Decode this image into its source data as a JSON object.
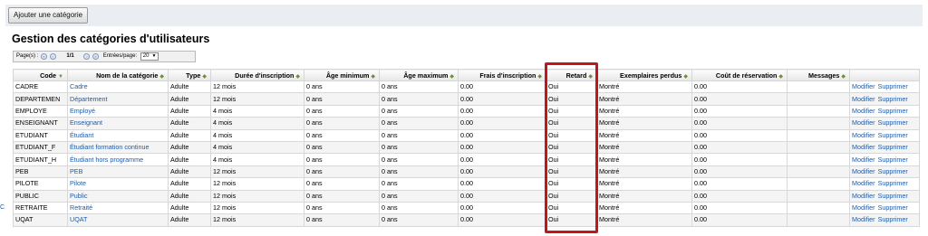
{
  "toolbar": {
    "add_category_label": "Ajouter une catégorie"
  },
  "page": {
    "title": "Gestion des catégories d'utilisateurs"
  },
  "pager": {
    "pages_label": "Page(s) :",
    "page_count": "1/1",
    "entries_label": "Entrées/page:",
    "entries_value": "20"
  },
  "columns": [
    "Code",
    "Nom de la catégorie",
    "Type",
    "Durée d'inscription",
    "Âge minimum",
    "Âge maximum",
    "Frais d'inscription",
    "Retard",
    "Exemplaires perdus",
    "Coût de réservation",
    "Messages",
    ""
  ],
  "rows": [
    {
      "code": "CADRE",
      "name": "Cadre",
      "type": "Adulte",
      "duration": "12 mois",
      "age_min": "0 ans",
      "age_max": "0 ans",
      "fee": "0.00",
      "overdue": "Oui",
      "lost": "Montré",
      "reserve_fee": "0.00",
      "messages": "",
      "edit": "Modifier",
      "delete": "Supprimer"
    },
    {
      "code": "DEPARTEMEN",
      "name": "Département",
      "type": "Adulte",
      "duration": "12 mois",
      "age_min": "0 ans",
      "age_max": "0 ans",
      "fee": "0.00",
      "overdue": "Oui",
      "lost": "Montré",
      "reserve_fee": "0.00",
      "messages": "",
      "edit": "Modifier",
      "delete": "Supprimer"
    },
    {
      "code": "EMPLOYE",
      "name": "Employé",
      "type": "Adulte",
      "duration": "4 mois",
      "age_min": "0 ans",
      "age_max": "0 ans",
      "fee": "0.00",
      "overdue": "Oui",
      "lost": "Montré",
      "reserve_fee": "0.00",
      "messages": "",
      "edit": "Modifier",
      "delete": "Supprimer"
    },
    {
      "code": "ENSEIGNANT",
      "name": "Enseignant",
      "type": "Adulte",
      "duration": "4 mois",
      "age_min": "0 ans",
      "age_max": "0 ans",
      "fee": "0.00",
      "overdue": "Oui",
      "lost": "Montré",
      "reserve_fee": "0.00",
      "messages": "",
      "edit": "Modifier",
      "delete": "Supprimer"
    },
    {
      "code": "ETUDIANT",
      "name": "Étudiant",
      "type": "Adulte",
      "duration": "4 mois",
      "age_min": "0 ans",
      "age_max": "0 ans",
      "fee": "0.00",
      "overdue": "Oui",
      "lost": "Montré",
      "reserve_fee": "0.00",
      "messages": "",
      "edit": "Modifier",
      "delete": "Supprimer"
    },
    {
      "code": "ETUDIANT_F",
      "name": "Étudiant formation continue",
      "type": "Adulte",
      "duration": "4 mois",
      "age_min": "0 ans",
      "age_max": "0 ans",
      "fee": "0.00",
      "overdue": "Oui",
      "lost": "Montré",
      "reserve_fee": "0.00",
      "messages": "",
      "edit": "Modifier",
      "delete": "Supprimer"
    },
    {
      "code": "ETUDIANT_H",
      "name": "Étudiant hors programme",
      "type": "Adulte",
      "duration": "4 mois",
      "age_min": "0 ans",
      "age_max": "0 ans",
      "fee": "0.00",
      "overdue": "Oui",
      "lost": "Montré",
      "reserve_fee": "0.00",
      "messages": "",
      "edit": "Modifier",
      "delete": "Supprimer"
    },
    {
      "code": "PEB",
      "name": "PEB",
      "type": "Adulte",
      "duration": "12 mois",
      "age_min": "0 ans",
      "age_max": "0 ans",
      "fee": "0.00",
      "overdue": "Oui",
      "lost": "Montré",
      "reserve_fee": "0.00",
      "messages": "",
      "edit": "Modifier",
      "delete": "Supprimer"
    },
    {
      "code": "PILOTE",
      "name": "Pilote",
      "type": "Adulte",
      "duration": "12 mois",
      "age_min": "0 ans",
      "age_max": "0 ans",
      "fee": "0.00",
      "overdue": "Oui",
      "lost": "Montré",
      "reserve_fee": "0.00",
      "messages": "",
      "edit": "Modifier",
      "delete": "Supprimer"
    },
    {
      "code": "PUBLIC",
      "name": "Public",
      "type": "Adulte",
      "duration": "12 mois",
      "age_min": "0 ans",
      "age_max": "0 ans",
      "fee": "0.00",
      "overdue": "Oui",
      "lost": "Montré",
      "reserve_fee": "0.00",
      "messages": "",
      "edit": "Modifier",
      "delete": "Supprimer"
    },
    {
      "code": "RETRAITE",
      "name": "Retraité",
      "type": "Adulte",
      "duration": "12 mois",
      "age_min": "0 ans",
      "age_max": "0 ans",
      "fee": "0.00",
      "overdue": "Oui",
      "lost": "Montré",
      "reserve_fee": "0.00",
      "messages": "",
      "edit": "Modifier",
      "delete": "Supprimer"
    },
    {
      "code": "UQAT",
      "name": "UQAT",
      "type": "Adulte",
      "duration": "12 mois",
      "age_min": "0 ans",
      "age_max": "0 ans",
      "fee": "0.00",
      "overdue": "Oui",
      "lost": "Montré",
      "reserve_fee": "0.00",
      "messages": "",
      "edit": "Modifier",
      "delete": "Supprimer"
    }
  ],
  "edge_fragment": "C",
  "colors": {
    "link": "#1f5ba6",
    "highlight": "#c0171b",
    "toolbar_bg": "#eaeef3"
  }
}
